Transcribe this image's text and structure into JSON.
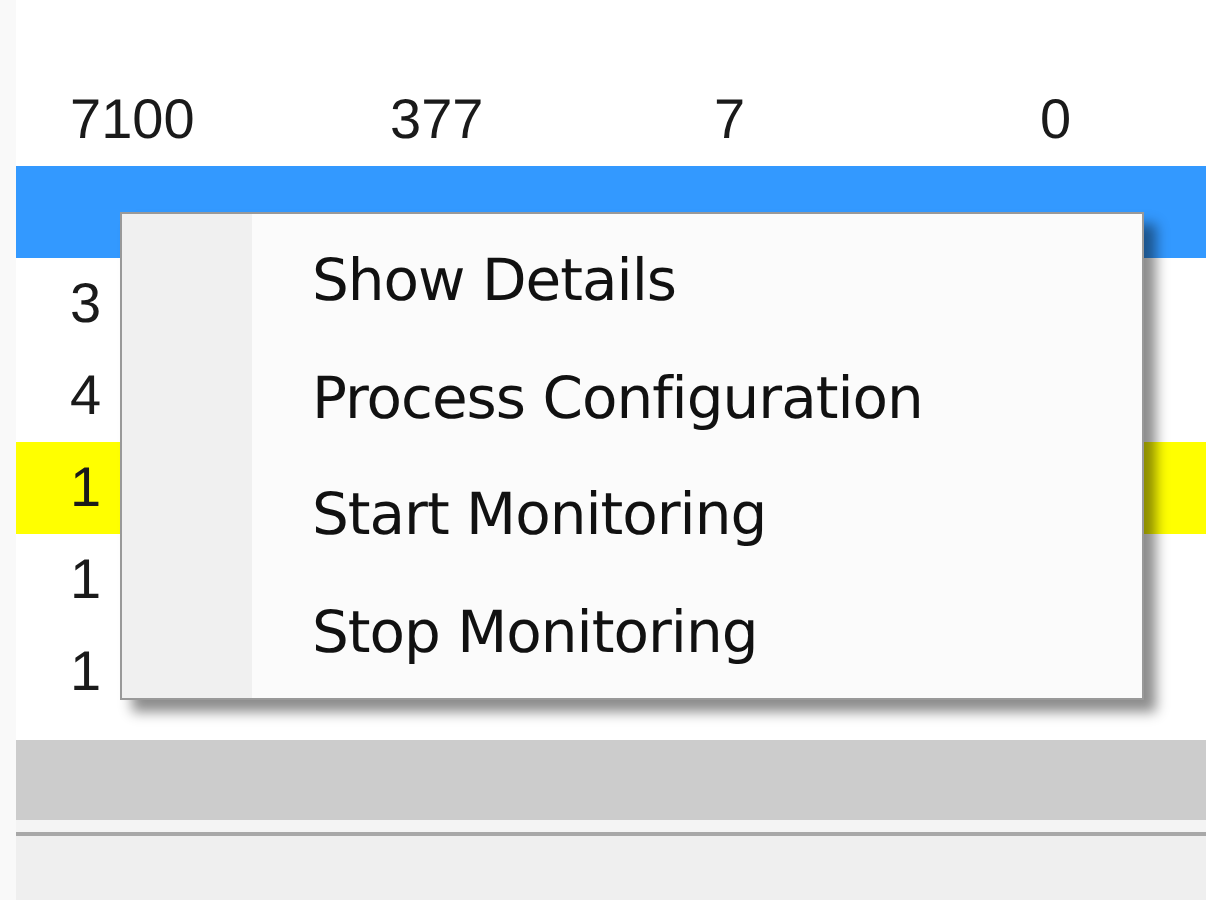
{
  "table": {
    "rows": [
      {
        "selected": false,
        "highlighted": false,
        "cells": [
          "7100",
          "377",
          "7",
          "0"
        ]
      },
      {
        "selected": true,
        "highlighted": false
      },
      {
        "selected": false,
        "highlighted": false,
        "cells": [
          "3"
        ]
      },
      {
        "selected": false,
        "highlighted": false,
        "cells": [
          "4"
        ]
      },
      {
        "selected": false,
        "highlighted": true,
        "cells": [
          "1"
        ]
      },
      {
        "selected": false,
        "highlighted": false,
        "cells": [
          "1"
        ]
      },
      {
        "selected": false,
        "highlighted": false,
        "cells": [
          "1"
        ]
      }
    ]
  },
  "context_menu": {
    "items": [
      {
        "label": "Show Details"
      },
      {
        "label": "Process Configuration"
      },
      {
        "label": "Start Monitoring"
      },
      {
        "label": "Stop Monitoring"
      }
    ]
  }
}
